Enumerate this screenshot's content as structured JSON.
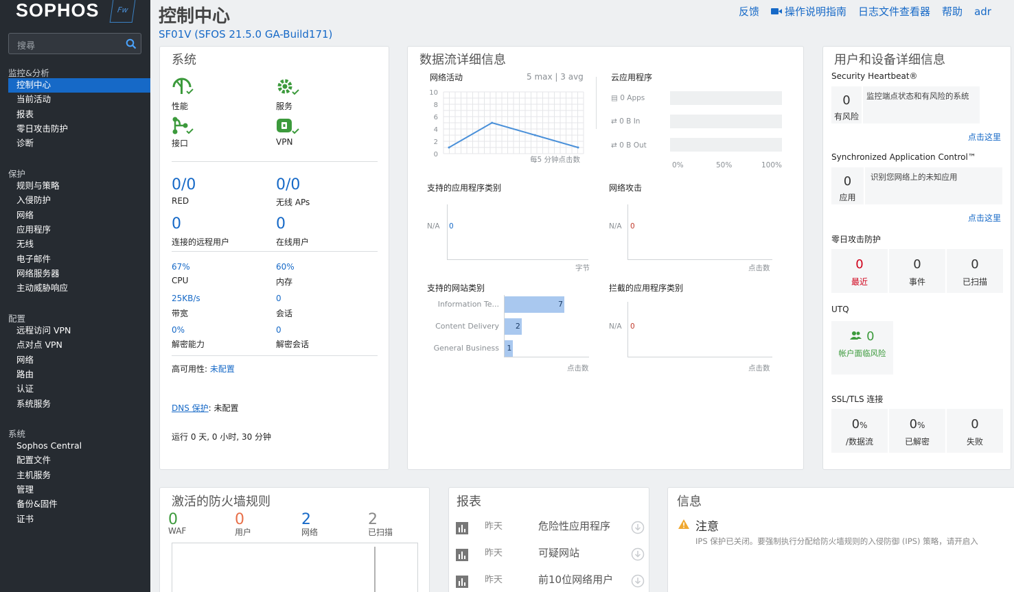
{
  "brand": {
    "logo": "SOPHOS",
    "badge": "Fw"
  },
  "search": {
    "placeholder": "搜尋"
  },
  "nav": {
    "sec1": "监控&分析",
    "sec1_items": [
      "控制中心",
      "当前活动",
      "报表",
      "零日攻击防护",
      "诊断"
    ],
    "sec2": "保护",
    "sec2_items": [
      "规则与策略",
      "入侵防护",
      "网络",
      "应用程序",
      "无线",
      "电子邮件",
      "网络服务器",
      "主动威胁响应"
    ],
    "sec3": "配置",
    "sec3_items": [
      "远程访问 VPN",
      "点对点 VPN",
      "网络",
      "路由",
      "认证",
      "系统服务"
    ],
    "sec4": "系统",
    "sec4_items": [
      "Sophos Central",
      "配置文件",
      "主机服务",
      "管理",
      "备份&固件",
      "证书"
    ]
  },
  "header": {
    "title": "控制中心",
    "subtitle": "SF01V (SFOS 21.5.0 GA-Build171)",
    "links": [
      "反馈",
      "操作说明指南",
      "日志文件查看器",
      "帮助",
      "adr"
    ]
  },
  "system": {
    "title": "系统",
    "icons": [
      {
        "label": "性能",
        "icon": "performance-icon"
      },
      {
        "label": "服务",
        "icon": "gear-icon"
      },
      {
        "label": "接口",
        "icon": "interface-icon"
      },
      {
        "label": "VPN",
        "icon": "vpn-lock-icon"
      }
    ],
    "red": {
      "value": "0/0",
      "label": "RED"
    },
    "aps": {
      "value": "0/0",
      "label": "无线 APs"
    },
    "remote": {
      "value": "0",
      "label": "连接的远程用户"
    },
    "online": {
      "value": "0",
      "label": "在线用户"
    },
    "cpu": {
      "value": "67%",
      "label": "CPU"
    },
    "mem": {
      "value": "60%",
      "label": "内存"
    },
    "bw": {
      "value": "25KB/s",
      "label": "带宽"
    },
    "sess": {
      "value": "0",
      "label": "会话"
    },
    "dec": {
      "value": "0%",
      "label": "解密能力"
    },
    "decs": {
      "value": "0",
      "label": "解密会话"
    },
    "ha_label": "高可用性:",
    "ha_value": "未配置",
    "dns_label": "DNS 保护",
    "dns_value": ": 未配置",
    "uptime": "运行 0 天, 0 小时, 30 分钟"
  },
  "traffic": {
    "title": "数据流详细信息",
    "net": {
      "title": "网络活动",
      "max": "5 max",
      "avg": "3 avg",
      "yticks": [
        "10",
        "8",
        "6",
        "4",
        "2",
        "0"
      ],
      "xlabel": "每5 分钟点击数",
      "values": [
        1,
        5,
        3,
        1
      ]
    },
    "cloud": {
      "title": "云应用程序",
      "rows": [
        "0 Apps",
        "0 B In",
        "0 B Out"
      ],
      "xticks": [
        "0%",
        "50%",
        "100%"
      ]
    },
    "apps": {
      "title": "支持的应用程序类别",
      "na": "N/A",
      "val": "0",
      "unit": "字节"
    },
    "attack": {
      "title": "网络攻击",
      "na": "N/A",
      "val": "0",
      "unit": "点击数"
    },
    "web": {
      "title": "支持的网站类别",
      "cats": [
        "Information Te...",
        "Content Delivery",
        "General Business"
      ],
      "values": [
        7,
        2,
        1
      ],
      "unit": "点击数"
    },
    "blocked": {
      "title": "拦截的应用程序类别",
      "na": "N/A",
      "val": "0",
      "unit": "点击数"
    }
  },
  "users": {
    "title": "用户和设备详细信息",
    "hb": {
      "title": "Security Heartbeat®",
      "num": "0",
      "lab": "有风险",
      "desc": "监控端点状态和有风险的系统",
      "link": "点击这里"
    },
    "sac": {
      "title": "Synchronized Application Control™",
      "num": "0",
      "lab": "应用",
      "desc": "识别您网络上的未知应用",
      "link": "点击这里"
    },
    "zero": {
      "title": "零日攻击防护",
      "tiles": [
        {
          "n": "0",
          "t": "最近"
        },
        {
          "n": "0",
          "t": "事件"
        },
        {
          "n": "0",
          "t": "已扫描"
        }
      ]
    },
    "utq": {
      "title": "UTQ",
      "num": "0",
      "lab": "帐户面临风险"
    },
    "ssl": {
      "title": "SSL/TLS 连接",
      "tiles": [
        {
          "n": "0",
          "u": "%",
          "t": "/数据流"
        },
        {
          "n": "0",
          "u": "%",
          "t": "已解密"
        },
        {
          "n": "0",
          "u": "",
          "t": "失败"
        }
      ]
    }
  },
  "fw": {
    "title": "激活的防火墙规则",
    "stats": [
      {
        "n": "0",
        "t": "WAF",
        "color": "#3c9a3c"
      },
      {
        "n": "0",
        "t": "用户",
        "color": "#e8704a"
      },
      {
        "n": "2",
        "t": "网络",
        "color": "#1669c7"
      },
      {
        "n": "2",
        "t": "已扫描",
        "color": "#888888"
      }
    ]
  },
  "reports": {
    "title": "报表",
    "rows": [
      {
        "when": "昨天",
        "name": "危险性应用程序"
      },
      {
        "when": "昨天",
        "name": "可疑网站"
      },
      {
        "when": "昨天",
        "name": "前10位网络用户"
      }
    ]
  },
  "info": {
    "title": "信息",
    "head": "注意",
    "text": "IPS 保护已关闭。要强制执行分配给防火墙规则的入侵防御 (IPS) 策略，请开启入"
  }
}
